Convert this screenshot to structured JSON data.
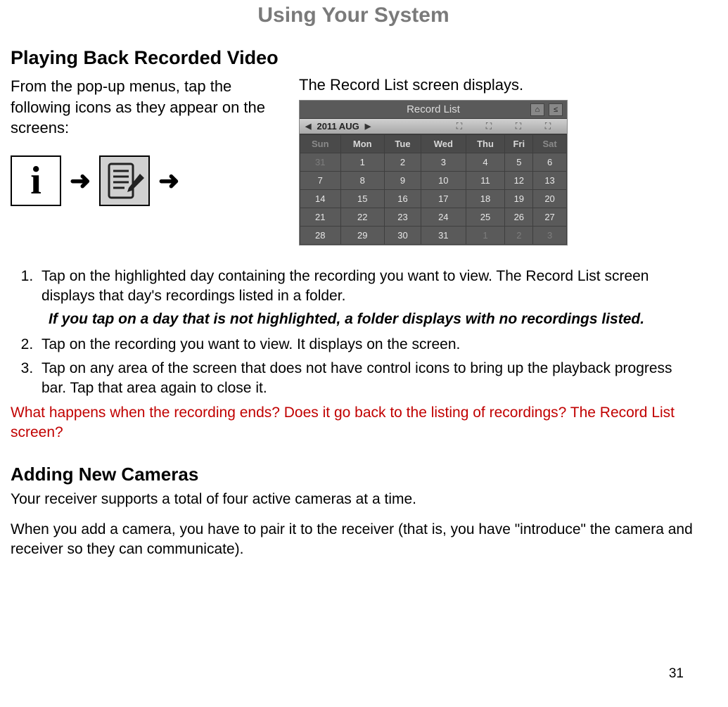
{
  "page_title": "Using Your System",
  "section1": {
    "heading": "Playing Back Recorded Video",
    "intro": "From the pop-up menus, tap the following icons as they appear on the screens:",
    "arrow": "➜",
    "right_caption": "The Record List screen displays."
  },
  "record_list": {
    "title": "Record List",
    "month": "2011 AUG",
    "days": [
      "Sun",
      "Mon",
      "Tue",
      "Wed",
      "Thu",
      "Fri",
      "Sat"
    ],
    "rows": [
      [
        {
          "v": "31",
          "dim": true
        },
        {
          "v": "1"
        },
        {
          "v": "2"
        },
        {
          "v": "3"
        },
        {
          "v": "4"
        },
        {
          "v": "5"
        },
        {
          "v": "6"
        }
      ],
      [
        {
          "v": "7"
        },
        {
          "v": "8"
        },
        {
          "v": "9"
        },
        {
          "v": "10"
        },
        {
          "v": "11"
        },
        {
          "v": "12"
        },
        {
          "v": "13"
        }
      ],
      [
        {
          "v": "14"
        },
        {
          "v": "15"
        },
        {
          "v": "16"
        },
        {
          "v": "17"
        },
        {
          "v": "18"
        },
        {
          "v": "19"
        },
        {
          "v": "20"
        }
      ],
      [
        {
          "v": "21"
        },
        {
          "v": "22"
        },
        {
          "v": "23"
        },
        {
          "v": "24"
        },
        {
          "v": "25"
        },
        {
          "v": "26"
        },
        {
          "v": "27"
        }
      ],
      [
        {
          "v": "28"
        },
        {
          "v": "29"
        },
        {
          "v": "30"
        },
        {
          "v": "31"
        },
        {
          "v": "1",
          "dim": true
        },
        {
          "v": "2",
          "dim": true
        },
        {
          "v": "3",
          "dim": true
        }
      ]
    ],
    "home_sym": "⌂",
    "back_sym": "≤"
  },
  "steps": {
    "s1": "Tap on the highlighted day containing the recording you want to view.  The Record List screen displays that day's recordings listed in a folder.",
    "note": "If you tap on a day that is not highlighted, a folder displays with no recordings listed.",
    "s2": "Tap on the recording you want to view. It displays on the screen.",
    "s3": "Tap on any area of the screen that does not have control icons to bring up the playback progress bar. Tap that area again to close it."
  },
  "review_comment": "What happens when the recording ends? Does it go back to the listing of recordings? The Record List screen?",
  "section2": {
    "heading": "Adding New Cameras",
    "p1": "Your receiver supports a total of four active cameras at a time.",
    "p2": "When you add a camera, you have to pair it to the receiver (that is, you have \"introduce\" the camera and receiver so they can communicate)."
  },
  "page_number": "31"
}
